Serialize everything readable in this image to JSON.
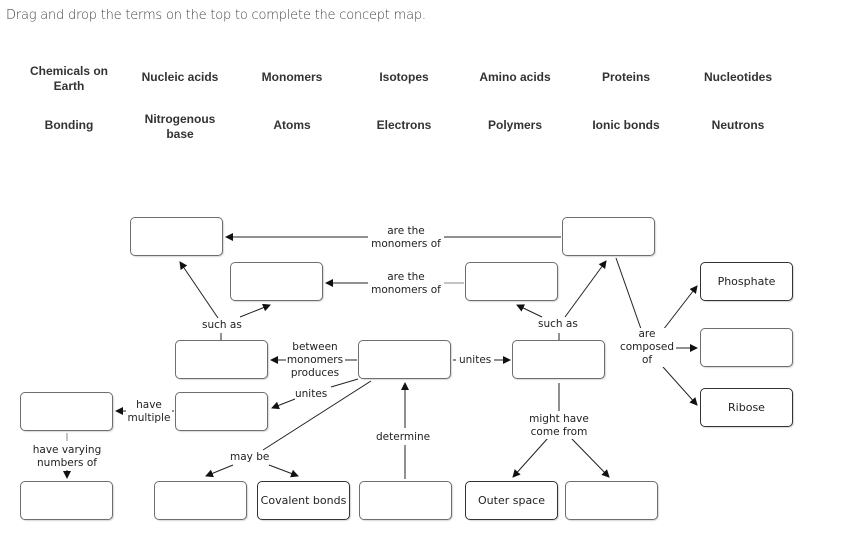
{
  "instructions": "Drag and drop the terms on the top to complete the concept map.",
  "term_bank": {
    "row1": [
      "Chemicals on Earth",
      "Nucleic acids",
      "Monomers",
      "Isotopes",
      "Amino acids",
      "Proteins",
      "Nucleotides"
    ],
    "row2": [
      "Bonding",
      "Nitrogenous base",
      "Atoms",
      "Electrons",
      "Polymers",
      "Ionic bonds",
      "Neutrons"
    ]
  },
  "nodes": {
    "top_left": "",
    "top_right": "",
    "mid_left": "",
    "mid_right": "",
    "phosphate": "Phosphate",
    "composed_mid": "",
    "ribose": "Ribose",
    "such_as_left_target": "",
    "center": "",
    "unites_target": "",
    "have_multiple_source": "",
    "have_multiple_target": "",
    "varying_target": "",
    "may_be_left": "",
    "covalent": "Covalent bonds",
    "determine_source": "",
    "outer_space": "Outer space",
    "come_from_right": ""
  },
  "links": {
    "are_monomers_of_1": "are the\nmonomers of",
    "are_monomers_of_2": "are the\nmonomers of",
    "such_as_left": "such as",
    "such_as_right": "such as",
    "between_produces": "between\nmonomers\nproduces",
    "unites_right": "unites",
    "unites_down": "unites",
    "are_composed_of": "are\ncomposed\nof",
    "have_multiple": "have\nmultiple",
    "have_varying": "have varying\nnumbers of",
    "may_be": "may be",
    "determine": "determine",
    "might_have_come_from": "might have\ncome from"
  }
}
